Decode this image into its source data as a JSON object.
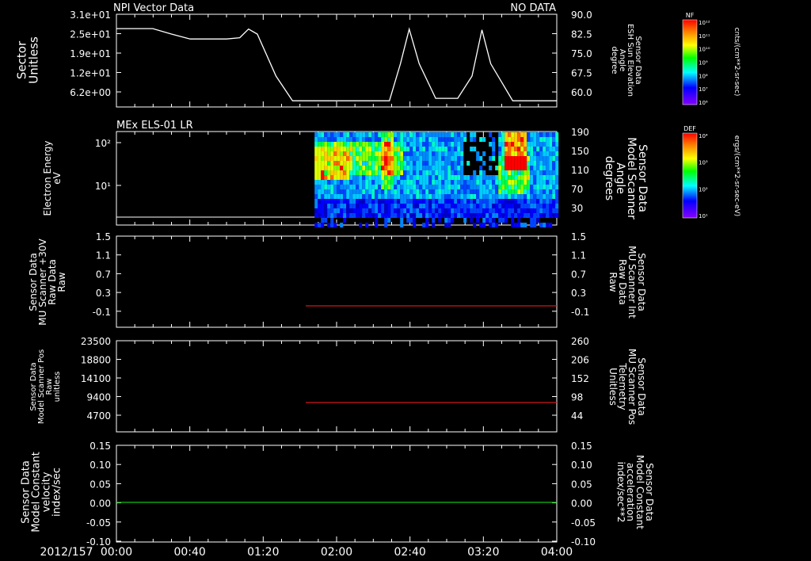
{
  "colors": {
    "background": "#000000",
    "foreground": "#ffffff",
    "red_axis": "#ff2020",
    "green_axis": "#22ee22",
    "red_trace": "#d01818",
    "green_trace": "#10c010"
  },
  "header": {
    "panel1_title": "NPI Vector Data",
    "panel1_status": "NO DATA",
    "panel2_title": "MEx ELS-01 LR"
  },
  "time_axis": {
    "date_label": "2012/157",
    "ticks": [
      "00:00",
      "00:40",
      "01:20",
      "02:00",
      "02:40",
      "03:20",
      "04:00"
    ]
  },
  "colorbars": [
    {
      "tag": "NF",
      "label": "cnts/(cm**2-sr-sec)",
      "ticks": [
        "10¹²",
        "10¹¹",
        "10¹⁰",
        "10⁹",
        "10⁸",
        "10⁷",
        "10⁶"
      ]
    },
    {
      "tag": "DEF",
      "label": "ergs/(cm**2-sr-sec-eV)",
      "ticks": [
        "10⁴",
        "10³",
        "10²",
        "10¹"
      ]
    }
  ],
  "chart_data": [
    {
      "type": "line",
      "panel": "NPI Vector Data",
      "left_axis": {
        "label_lines": [
          "Sector",
          "Unitless"
        ],
        "ticks": [
          "3.1e+01",
          "2.5e+01",
          "1.9e+01",
          "1.2e+01",
          "6.2e+00"
        ]
      },
      "right_axis": {
        "label_lines": [
          "Sensor Data",
          "ESH Sun Elevation",
          "Angle",
          "degree"
        ],
        "ticks": [
          "90.0",
          "82.5",
          "75.0",
          "67.5",
          "60.0"
        ],
        "ylim": [
          52.5,
          90.0
        ]
      },
      "series": [
        {
          "name": "ESH Sun Elevation Angle",
          "x_hours": [
            0.0,
            0.33,
            0.5,
            0.67,
            1.0,
            1.12,
            1.2,
            1.28,
            1.45,
            1.6,
            1.75,
            2.0,
            2.3,
            2.48,
            2.58,
            2.66,
            2.75,
            2.9,
            3.1,
            3.23,
            3.32,
            3.4,
            3.6,
            4.0
          ],
          "y_degrees": [
            84.2,
            84.2,
            82.0,
            80.0,
            80.0,
            80.5,
            84.0,
            82.0,
            65.0,
            55.0,
            55.0,
            55.0,
            55.0,
            55.0,
            70.0,
            84.0,
            70.0,
            56.0,
            56.0,
            65.0,
            83.7,
            70.0,
            55.0,
            55.0
          ]
        }
      ]
    },
    {
      "type": "heatmap",
      "panel": "MEx ELS-01 LR",
      "left_axis": {
        "label_lines": [
          "Electron Energy",
          "eV"
        ],
        "ticks": [
          "10²",
          "10¹"
        ]
      },
      "right_axis": {
        "label_lines": [
          "Sensor Data",
          "Model Scanner",
          "Angle",
          "degrees"
        ],
        "ticks": [
          "190",
          "150",
          "110",
          "70",
          "30"
        ]
      },
      "data_start_hour": 1.8,
      "note_levels": "colour intensity by time (hours) and energy row; high flux near 02:00 and 03:40"
    },
    {
      "type": "line",
      "panel": "MU Scanner Int",
      "left_axis": {
        "label_lines": [
          "Sensor Data",
          "MU Scanner +30V",
          "Raw Data",
          "Raw"
        ],
        "ticks": [
          "1.5",
          "1.1",
          "0.7",
          "0.3",
          "-0.1"
        ],
        "ylim": [
          -0.5,
          1.5
        ]
      },
      "right_axis": {
        "label_lines": [
          "Sensor Data",
          "MU Scanner Int",
          "Raw Data",
          "Raw"
        ],
        "ticks": [
          "1.5",
          "1.1",
          "0.7",
          "0.3",
          "-0.1"
        ],
        "color": "red"
      },
      "series": [
        {
          "x_hours": [
            1.72,
            4.0
          ],
          "y": [
            0.0,
            0.0
          ],
          "color": "red"
        }
      ]
    },
    {
      "type": "line",
      "panel": "MU Scanner Pos",
      "left_axis": {
        "label_lines": [
          "Sensor Data",
          "Model Scanner Pos",
          "Raw",
          "unitless"
        ],
        "ticks": [
          "23500",
          "18800",
          "14100",
          "9400",
          "4700"
        ],
        "ylim": [
          0,
          23500
        ]
      },
      "right_axis": {
        "label_lines": [
          "Sensor Data",
          "MU Scanner Pos",
          "Telemetry",
          "Unitless"
        ],
        "ticks": [
          "260",
          "206",
          "152",
          "98",
          "44"
        ],
        "ylim": [
          -10,
          260
        ],
        "color": "red"
      },
      "series": [
        {
          "x_hours": [
            1.72,
            4.0
          ],
          "y_right": [
            80,
            80
          ],
          "color": "red"
        }
      ]
    },
    {
      "type": "line",
      "panel": "Model Constant",
      "left_axis": {
        "label_lines": [
          "Sensor Data",
          "Model Constant",
          "velocity",
          "index/sec"
        ],
        "ticks": [
          "0.15",
          "0.10",
          "0.05",
          "0.00",
          "-0.05",
          "-0.10"
        ],
        "ylim": [
          -0.1,
          0.15
        ]
      },
      "right_axis": {
        "label_lines": [
          "Sensor Data",
          "Model Constant",
          "acceleration",
          "index/sec**2"
        ],
        "ticks": [
          "0.15",
          "0.10",
          "0.05",
          "0.00",
          "-0.05",
          "-0.10"
        ],
        "color": "green"
      },
      "series": [
        {
          "x_hours": [
            0.0,
            4.0
          ],
          "y": [
            0.0,
            0.0
          ],
          "color": "green"
        }
      ]
    }
  ]
}
